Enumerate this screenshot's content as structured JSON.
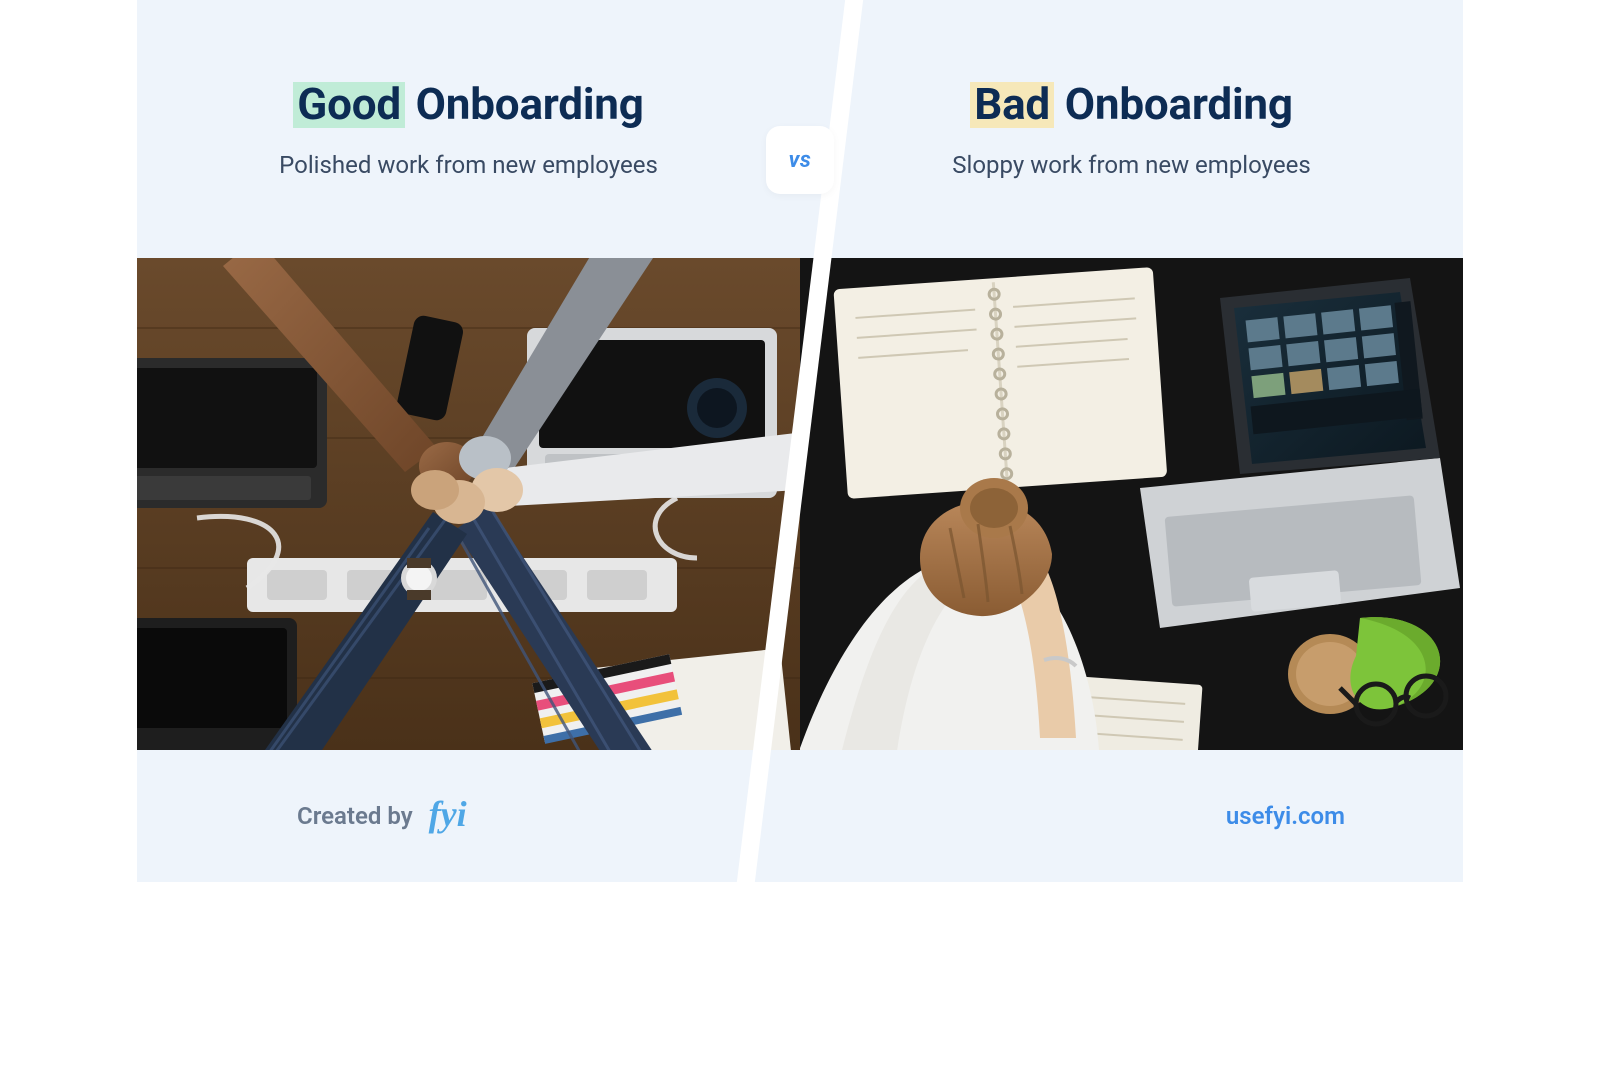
{
  "vs_label": "vs",
  "left": {
    "highlight": "Good",
    "title_rest": " Onboarding",
    "subtitle": "Polished work from new employees"
  },
  "right": {
    "highlight": "Bad",
    "title_rest": " Onboarding",
    "subtitle": "Sloppy work from new employees"
  },
  "footer": {
    "created_by": "Created by",
    "logo_text": "fyi",
    "url": "usefyi.com"
  },
  "colors": {
    "bg": "#eef4fb",
    "title": "#0d2c54",
    "accent_good": "#c0ecd7",
    "accent_bad": "#f6e8b9",
    "brand": "#4fa7e6",
    "link": "#3d8ce8"
  }
}
